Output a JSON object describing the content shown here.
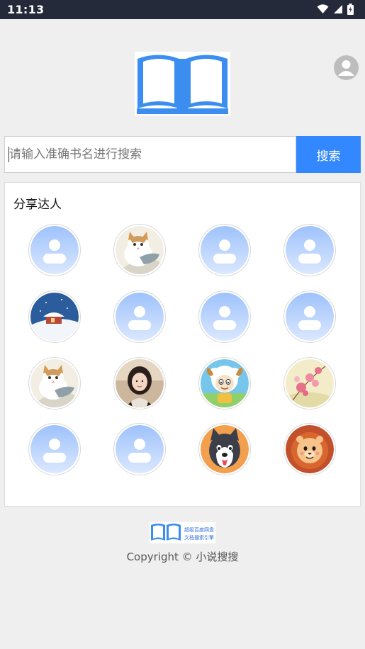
{
  "status_bar": {
    "time": "11:13"
  },
  "search": {
    "placeholder": "请输入准确书名进行搜索",
    "value": "",
    "button_label": "搜索"
  },
  "share": {
    "title": "分享达人",
    "avatars": [
      {
        "type": "default"
      },
      {
        "type": "cat"
      },
      {
        "type": "default"
      },
      {
        "type": "default"
      },
      {
        "type": "snow-house"
      },
      {
        "type": "default"
      },
      {
        "type": "default"
      },
      {
        "type": "default"
      },
      {
        "type": "cat"
      },
      {
        "type": "girl-photo"
      },
      {
        "type": "sheep-cartoon"
      },
      {
        "type": "flowers"
      },
      {
        "type": "default"
      },
      {
        "type": "default"
      },
      {
        "type": "husky-cartoon"
      },
      {
        "type": "lion-cartoon"
      }
    ]
  },
  "footer": {
    "logo_text_line1": "超级百度网盘",
    "logo_text_line2": "文档搜索引擎",
    "copyright": "Copyright © 小说搜搜"
  },
  "colors": {
    "status_bar": "#252a3b",
    "accent": "#3388ff",
    "logo_blue": "#3b8ef0",
    "background": "#efefef"
  }
}
